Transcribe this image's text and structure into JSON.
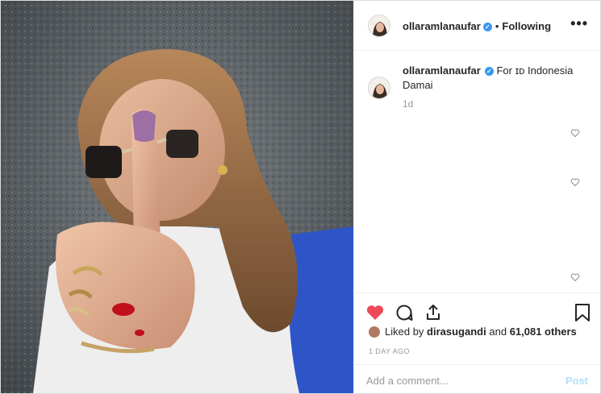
{
  "header": {
    "username": "ollaramlanaufar",
    "separator": "•",
    "follow_state": "Following",
    "more_label": "•••"
  },
  "caption": {
    "username": "ollaramlanaufar",
    "text": "For ɪᴅ Indonesia Damai",
    "time": "1d"
  },
  "likes": {
    "prefix": "Liked by",
    "user": "dirasugandi",
    "joiner": "and",
    "count": "61,081 others"
  },
  "timestamp": "1 DAY AGO",
  "comment": {
    "placeholder": "Add a comment...",
    "post_label": "Post"
  },
  "icons": {
    "like": "heart-filled-icon",
    "comment": "comment-icon",
    "share": "share-icon",
    "save": "bookmark-icon",
    "verified": "verified-badge-icon"
  },
  "colors": {
    "like_red": "#ed4956",
    "verified_blue": "#3897f0",
    "post_disabled": "#b2dffc"
  }
}
